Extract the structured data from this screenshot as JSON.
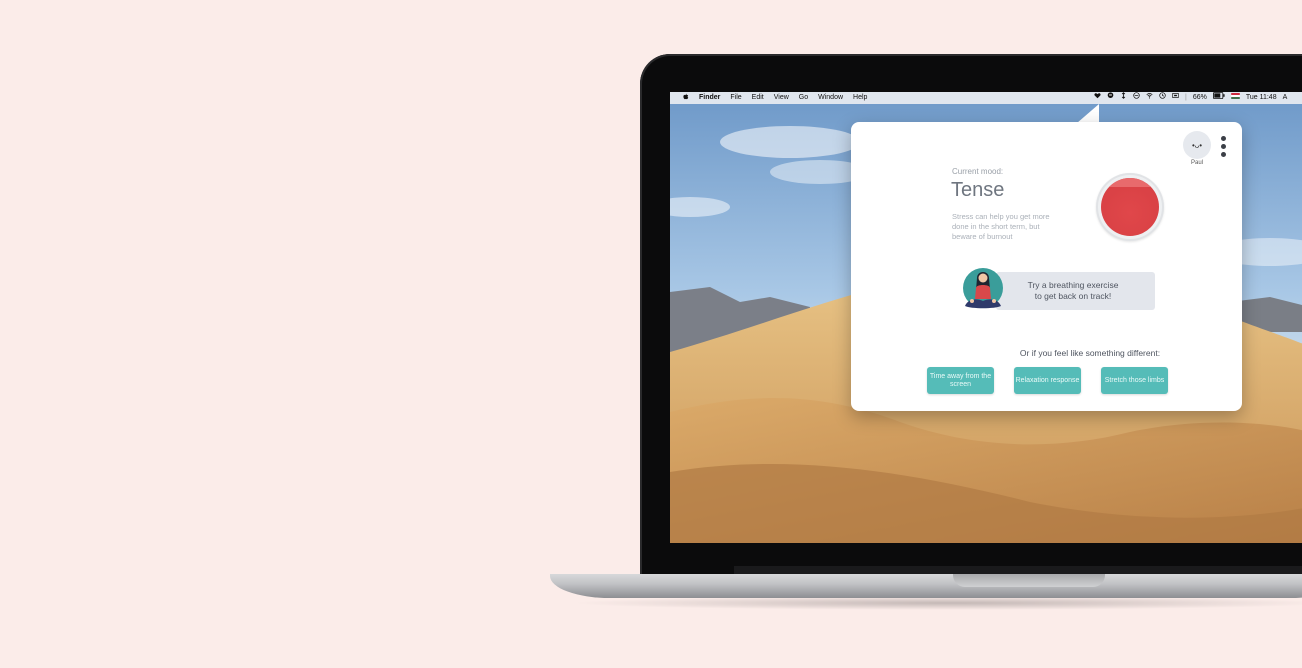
{
  "menubar": {
    "apple": "",
    "app": "Finder",
    "items": [
      "File",
      "Edit",
      "View",
      "Go",
      "Window",
      "Help"
    ],
    "battery": "66%",
    "clock": "Tue 11:48",
    "trail": "A"
  },
  "popup": {
    "user_name": "Paul",
    "avatar_face": "•ᴗ•",
    "mood_label": "Current mood:",
    "mood": "Tense",
    "mood_description": "Stress can help you get more done in the short term, but beware of burnout",
    "mood_color": "#e0474a",
    "breathing_prompt_line1": "Try a breathing exercise",
    "breathing_prompt_line2": "to get back on track!",
    "alternatives_title": "Or if you feel like something different:",
    "alternatives": [
      {
        "label": "Time away from the screen"
      },
      {
        "label": "Relaxation response"
      },
      {
        "label": "Stretch those limbs"
      }
    ],
    "accent": "#55bcb8"
  }
}
